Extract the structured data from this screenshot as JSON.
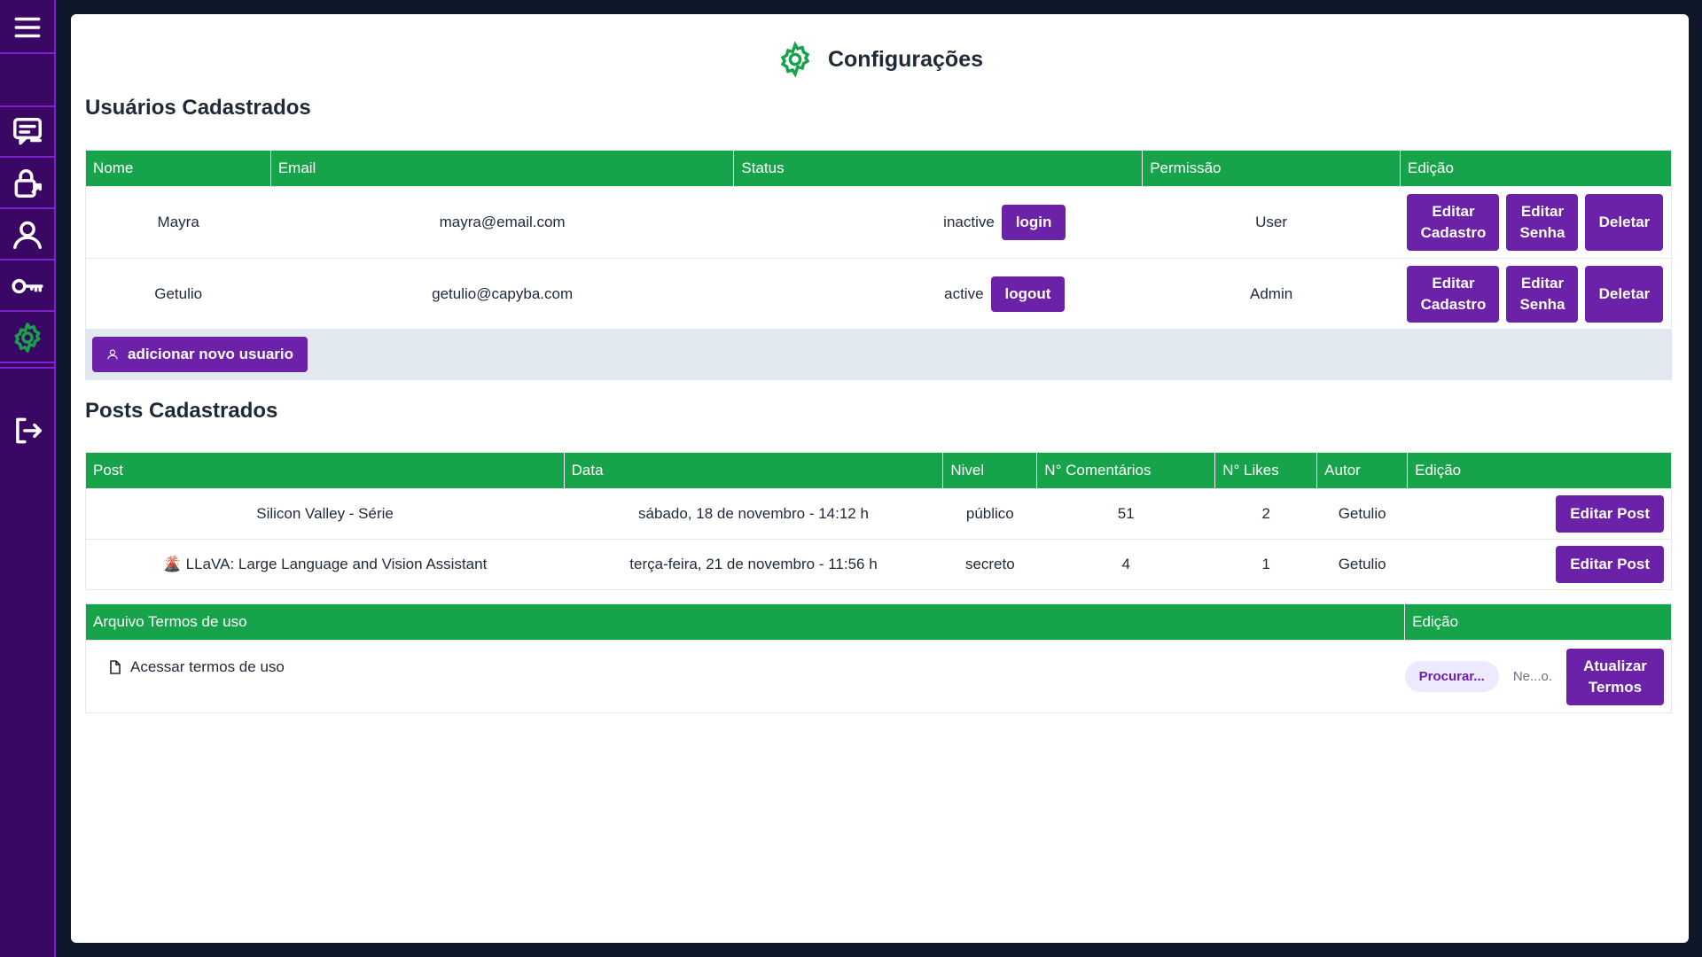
{
  "sidebar": {
    "items": [
      {
        "icon": "menu-icon"
      },
      {
        "icon": "chat-icon"
      },
      {
        "icon": "lock-icon"
      },
      {
        "icon": "user-icon"
      },
      {
        "icon": "key-icon"
      },
      {
        "icon": "gear-icon",
        "active": true
      },
      {
        "icon": "logout-icon"
      }
    ]
  },
  "header": {
    "title": "Configurações",
    "icon": "gear-icon"
  },
  "users": {
    "section_title": "Usuários Cadastrados",
    "columns": [
      "Nome",
      "Email",
      "Status",
      "Permissão",
      "Edição"
    ],
    "rows": [
      {
        "name": "Mayra",
        "email": "mayra@email.com",
        "status": "inactive",
        "status_button": "login",
        "permission": "User"
      },
      {
        "name": "Getulio",
        "email": "getulio@capyba.com",
        "status": "active",
        "status_button": "logout",
        "permission": "Admin"
      }
    ],
    "edit_register_label": "Editar Cadastro",
    "edit_password_label": "Editar Senha",
    "delete_label": "Deletar",
    "add_user_label": "adicionar novo usuario"
  },
  "posts": {
    "section_title": "Posts Cadastrados",
    "columns": [
      "Post",
      "Data",
      "Nivel",
      "N° Comentários",
      "N° Likes",
      "Autor",
      "Edição"
    ],
    "rows": [
      {
        "post": "Silicon Valley - Série",
        "date": "sábado, 18 de novembro - 14:12 h",
        "level": "público",
        "comments": "51",
        "likes": "2",
        "author": "Getulio"
      },
      {
        "post": "🌋 LLaVA: Large Language and Vision Assistant",
        "date": "terça-feira, 21 de novembro - 11:56 h",
        "level": "secreto",
        "comments": "4",
        "likes": "1",
        "author": "Getulio"
      }
    ],
    "edit_post_label": "Editar Post"
  },
  "terms": {
    "columns": [
      "Arquivo Termos de uso",
      "Edição"
    ],
    "link_label": "Acessar termos de uso",
    "browse_label": "Procurar...",
    "file_name": "Ne...o.",
    "update_label": "Atualizar Termos"
  },
  "colors": {
    "sidebar": "#3b0764",
    "accent_green": "#16a34a",
    "button_purple": "#6b21a8"
  }
}
